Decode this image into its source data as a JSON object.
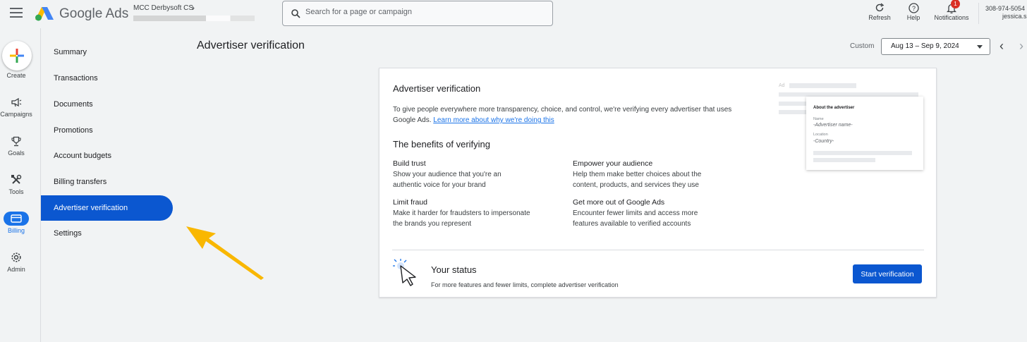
{
  "app": {
    "brand": "Google Ads",
    "account_name": "MCC Derbysoft CS",
    "search_placeholder": "Search for a page or campaign"
  },
  "header_tools": [
    {
      "label": "Refresh",
      "icon": "refresh-icon"
    },
    {
      "label": "Help",
      "icon": "help-icon"
    },
    {
      "label": "Notifications",
      "icon": "bell-icon",
      "badge": "1"
    }
  ],
  "user": {
    "phone": "308-974-5054",
    "name": "jessica.s"
  },
  "rail": [
    {
      "label": "Create",
      "icon": "plus-icon"
    },
    {
      "label": "Campaigns",
      "icon": "megaphone-icon"
    },
    {
      "label": "Goals",
      "icon": "trophy-icon"
    },
    {
      "label": "Tools",
      "icon": "tools-icon"
    },
    {
      "label": "Billing",
      "icon": "billing-icon",
      "active": true
    },
    {
      "label": "Admin",
      "icon": "gear-icon"
    }
  ],
  "nav": [
    {
      "label": "Summary"
    },
    {
      "label": "Transactions"
    },
    {
      "label": "Documents"
    },
    {
      "label": "Promotions"
    },
    {
      "label": "Account budgets"
    },
    {
      "label": "Billing transfers"
    },
    {
      "label": "Advertiser verification",
      "active": true
    },
    {
      "label": "Settings"
    }
  ],
  "page": {
    "title": "Advertiser verification",
    "date_mode": "Custom",
    "date_range": "Aug 13 – Sep 9, 2024"
  },
  "card": {
    "title": "Advertiser verification",
    "desc": "To give people everywhere more transparency, choice, and control, we're verifying every advertiser that uses Google Ads.",
    "link": "Learn more about why we're doing this",
    "benefits_title": "The benefits of verifying",
    "benefits": [
      {
        "title": "Build trust",
        "text": "Show your audience that you're an authentic voice for your brand"
      },
      {
        "title": "Empower your audience",
        "text": "Help them make better choices about the content, products, and services they use"
      },
      {
        "title": "Limit fraud",
        "text": "Make it harder for fraudsters to impersonate the brands you represent"
      },
      {
        "title": "Get more out of Google Ads",
        "text": "Encounter fewer limits and access more features available to verified accounts"
      }
    ],
    "preview": {
      "ad_label": "Ad",
      "heading": "About the advertiser",
      "name_label": "Name",
      "name_value": "-Advertiser name-",
      "location_label": "Location",
      "location_value": "-Country-"
    },
    "status_title": "Your status",
    "status_sub": "For more features and fewer limits, complete advertiser verification",
    "start_button": "Start verification"
  },
  "colors": {
    "accent": "#0b57d0",
    "pointer_arrow": "#f9b700"
  }
}
